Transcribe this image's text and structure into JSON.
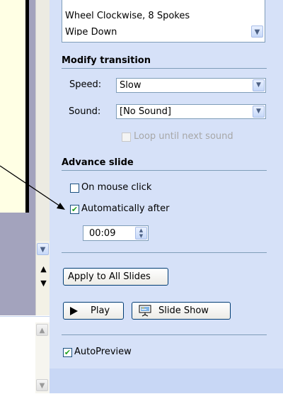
{
  "transition_list": {
    "item1": "Wheel Clockwise, 8 Spokes",
    "item2": "Wipe Down"
  },
  "modify_transition": {
    "title": "Modify transition",
    "speed_label": "Speed:",
    "speed_value": "Slow",
    "sound_label": "Sound:",
    "sound_value": "[No Sound]",
    "loop_label": "Loop until next sound",
    "loop_checked": false
  },
  "advance_slide": {
    "title": "Advance slide",
    "on_mouse_click_label": "On mouse click",
    "on_mouse_click_checked": false,
    "automatically_after_label": "Automatically after",
    "automatically_after_checked": true,
    "time_value": "00:09"
  },
  "buttons": {
    "apply_all": "Apply to All Slides",
    "play": "Play",
    "slide_show": "Slide Show"
  },
  "autopreview": {
    "label": "AutoPreview",
    "checked": true
  },
  "icons": {
    "dropdown": "chevron-down-icon",
    "check": "checkmark-icon",
    "play": "play-icon",
    "slideshow": "projector-screen-icon"
  },
  "colors": {
    "pane_bg": "#d6e1f8",
    "section_line": "#7f9db9",
    "check_green": "#21a121",
    "disabled_text": "#a7a7a7"
  }
}
